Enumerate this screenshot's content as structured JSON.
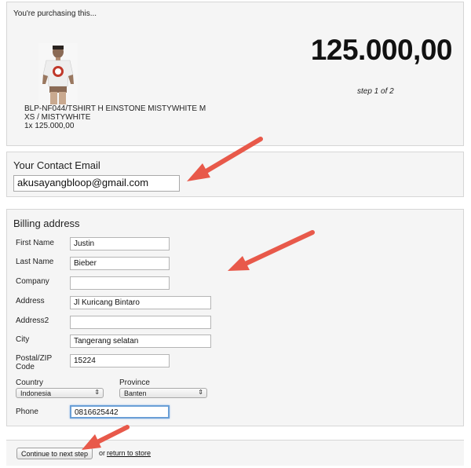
{
  "purchase": {
    "label": "You're purchasing this...",
    "product_line1": "BLP-NF044/TSHIRT H EINSTONE MISTYWHITE M",
    "product_line2": "XS / MISTYWHITE",
    "product_line3": "1x 125.000,00",
    "price": "125.000,00",
    "step": "step 1 of 2"
  },
  "contact": {
    "title": "Your Contact Email",
    "email_value": "akusayangbloop@gmail.com"
  },
  "billing": {
    "title": "Billing address",
    "first_name_label": "First Name",
    "first_name_value": "Justin",
    "last_name_label": "Last Name",
    "last_name_value": "Bieber",
    "company_label": "Company",
    "company_value": "",
    "address_label": "Address",
    "address_value": "Jl Kuricang Bintaro",
    "address2_label": "Address2",
    "address2_value": "",
    "city_label": "City",
    "city_value": "Tangerang selatan",
    "postal_label_line1": "Postal/ZIP",
    "postal_label_line2": "Code",
    "postal_value": "15224",
    "country_label": "Country",
    "country_value": "Indonesia",
    "province_label": "Province",
    "province_value": "Banten",
    "phone_label": "Phone",
    "phone_value": "0816625442"
  },
  "footer": {
    "continue_label": "Continue to next step",
    "or_text": "or",
    "return_label": "return to store"
  },
  "icons": {
    "select_chevron": "updown-chevron-icon",
    "annotation": "red-arrow-icon"
  },
  "colors": {
    "annotation_arrow": "#e8594a",
    "focus_ring": "#6a9fd6"
  }
}
